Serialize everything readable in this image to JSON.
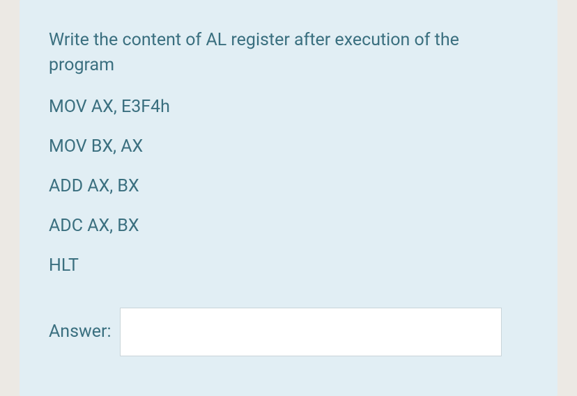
{
  "question": {
    "prompt": "Write the content of AL register after execution of the program",
    "code_lines": [
      "MOV AX, E3F4h",
      "MOV BX, AX",
      "ADD AX, BX",
      "ADC AX, BX",
      "HLT"
    ]
  },
  "answer": {
    "label": "Answer:",
    "value": ""
  }
}
